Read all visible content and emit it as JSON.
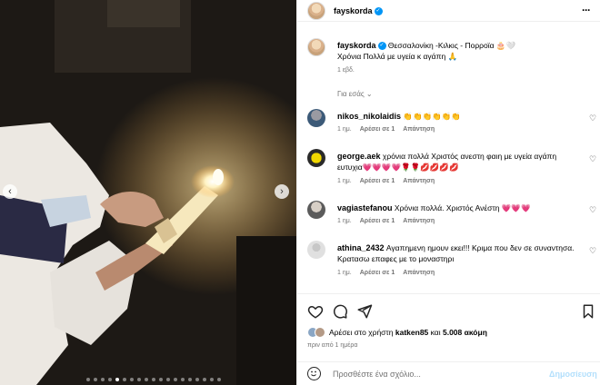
{
  "post": {
    "username": "fayskorda",
    "location_caption": "Θεσσαλονίκη -Κιλκις - Πορροϊα 🎂🤍",
    "caption_text": "Χρόνια Πολλά με υγεία κ αγάπη 🙏",
    "caption_time": "1 εβδ.",
    "see_translation": "Για εσάς",
    "more_icon": "more-horizontal-icon"
  },
  "comments": [
    {
      "user": "nikos_nikolaidis",
      "text": "👏👏👏👏👏👏",
      "time": "1 ημ.",
      "reply": "Αρέσει σε 1",
      "answer": "Απάντηση"
    },
    {
      "user": "george.aek",
      "text": "χρόνια πολλά Χριστός ανεστη φαιη με υγεία αγάπη ευτυχια💗💗💗💗🌹🌹💋💋💋💋",
      "time": "1 ημ.",
      "reply": "Αρέσει σε 1",
      "answer": "Απάντηση"
    },
    {
      "user": "vagiastefanou",
      "text": "Χρόνια πολλά. Χριστός Ανέστη 💗💗💗",
      "time": "1 ημ.",
      "reply": "Αρέσει σε 1",
      "answer": "Απάντηση"
    },
    {
      "user": "athina_2432",
      "text": "Αγαπημενη ημουν εκει!!! Κριμα που δεν σε συναντησα. Κρατασω επαφες με το μοναστηρι",
      "time": "1 ημ.",
      "reply": "Αρέσει σε 1",
      "answer": "Απάντηση"
    }
  ],
  "likes": {
    "prefix": "Αρέσει στο χρήστη",
    "user": "katken85",
    "mid": "και",
    "count": "5.008 ακόμη"
  },
  "posted_ago": "πριν από 1 ημέρα",
  "add_comment": {
    "placeholder": "Προσθέστε ένα σχόλιο...",
    "post_label": "Δημοσίευση"
  },
  "carousel": {
    "total": 19,
    "active": 4
  },
  "colors": {
    "verified": "#0095f6",
    "post_disabled": "#b2dffc",
    "meta": "#737373"
  }
}
